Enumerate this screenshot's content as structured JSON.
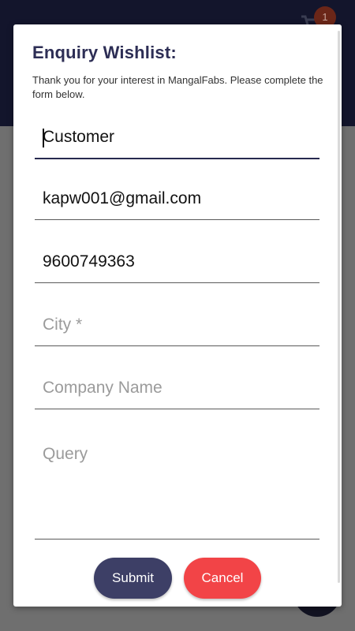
{
  "app": {
    "cart_count": "1"
  },
  "dialog": {
    "title": "Enquiry Wishlist:",
    "subtitle": "Thank you for your interest in MangalFabs. Please complete the form below.",
    "fields": [
      {
        "value": "Customer",
        "placeholder": ""
      },
      {
        "value": "kapw001@gmail.com",
        "placeholder": ""
      },
      {
        "value": "9600749363",
        "placeholder": ""
      },
      {
        "value": "",
        "placeholder": "City *"
      },
      {
        "value": "",
        "placeholder": "Company Name"
      },
      {
        "value": "",
        "placeholder": "Query"
      }
    ],
    "submit_label": "Submit",
    "cancel_label": "Cancel"
  },
  "colors": {
    "primary": "#3d3f66",
    "danger": "#f24447",
    "title": "#2d2e55",
    "header": "#13152c"
  }
}
